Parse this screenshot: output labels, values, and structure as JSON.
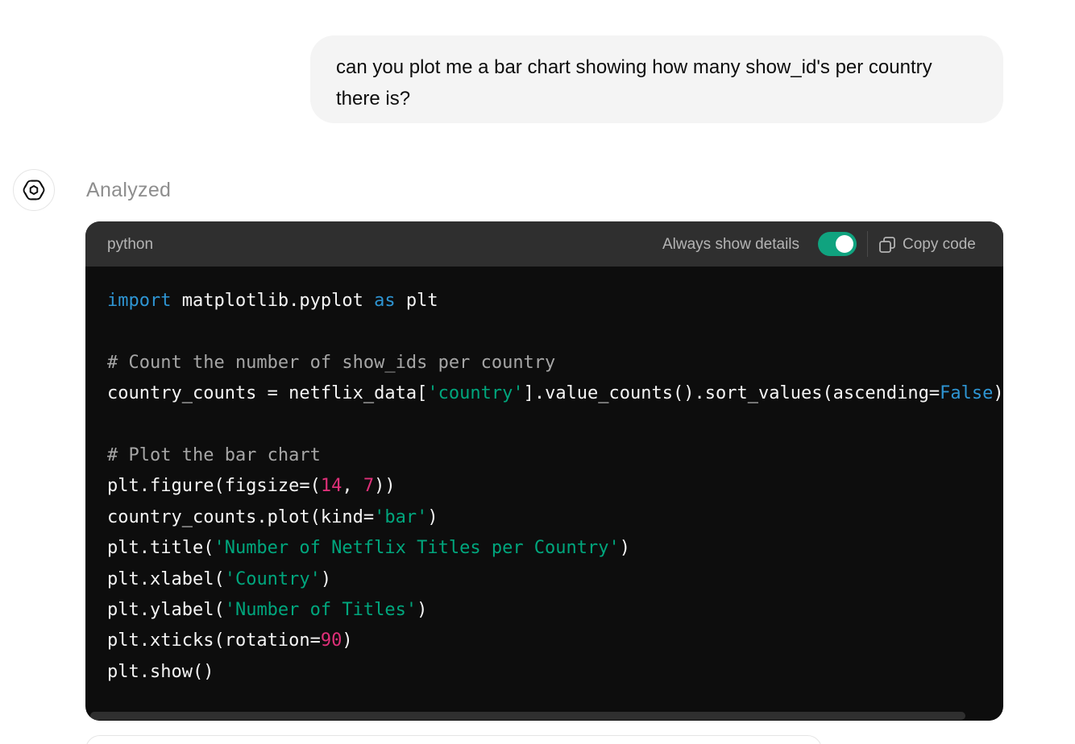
{
  "conversation": {
    "user_message": "can you plot me a bar chart showing how many show_id's per country there is?",
    "assistant_status": "Analyzed",
    "assistant_avatar_icon": "openai-logo-icon"
  },
  "code_block": {
    "language": "python",
    "details_label": "Always show details",
    "details_toggle_on": true,
    "copy_label": "Copy code",
    "copy_icon": "copy-icon",
    "lines": [
      [
        {
          "t": "import",
          "c": "kw"
        },
        {
          "t": " matplotlib.pyplot ",
          "c": ""
        },
        {
          "t": "as",
          "c": "kw"
        },
        {
          "t": " plt",
          "c": ""
        }
      ],
      [],
      [
        {
          "t": "# Count the number of show_ids per country",
          "c": "cm"
        }
      ],
      [
        {
          "t": "country_counts = netflix_data[",
          "c": ""
        },
        {
          "t": "'country'",
          "c": "st"
        },
        {
          "t": "].value_counts().sort_values(ascending=",
          "c": ""
        },
        {
          "t": "False",
          "c": "kw"
        },
        {
          "t": ")",
          "c": ""
        }
      ],
      [],
      [
        {
          "t": "# Plot the bar chart",
          "c": "cm"
        }
      ],
      [
        {
          "t": "plt.figure(figsize=(",
          "c": ""
        },
        {
          "t": "14",
          "c": "nm"
        },
        {
          "t": ", ",
          "c": ""
        },
        {
          "t": "7",
          "c": "nm"
        },
        {
          "t": "))",
          "c": ""
        }
      ],
      [
        {
          "t": "country_counts.plot(kind=",
          "c": ""
        },
        {
          "t": "'bar'",
          "c": "st"
        },
        {
          "t": ")",
          "c": ""
        }
      ],
      [
        {
          "t": "plt.title(",
          "c": ""
        },
        {
          "t": "'Number of Netflix Titles per Country'",
          "c": "st"
        },
        {
          "t": ")",
          "c": ""
        }
      ],
      [
        {
          "t": "plt.xlabel(",
          "c": ""
        },
        {
          "t": "'Country'",
          "c": "st"
        },
        {
          "t": ")",
          "c": ""
        }
      ],
      [
        {
          "t": "plt.ylabel(",
          "c": ""
        },
        {
          "t": "'Number of Titles'",
          "c": "st"
        },
        {
          "t": ")",
          "c": ""
        }
      ],
      [
        {
          "t": "plt.xticks(rotation=",
          "c": ""
        },
        {
          "t": "90",
          "c": "nm"
        },
        {
          "t": ")",
          "c": ""
        }
      ],
      [
        {
          "t": "plt.show()",
          "c": ""
        }
      ]
    ]
  },
  "colors": {
    "keyword": "#2e95d3",
    "comment": "#a6a6a6",
    "string": "#00a67d",
    "number": "#df3079",
    "toggle_on": "#10a37f",
    "code_background": "#0d0d0d",
    "code_header": "#2f2f2f",
    "user_bubble": "#f4f4f4"
  }
}
